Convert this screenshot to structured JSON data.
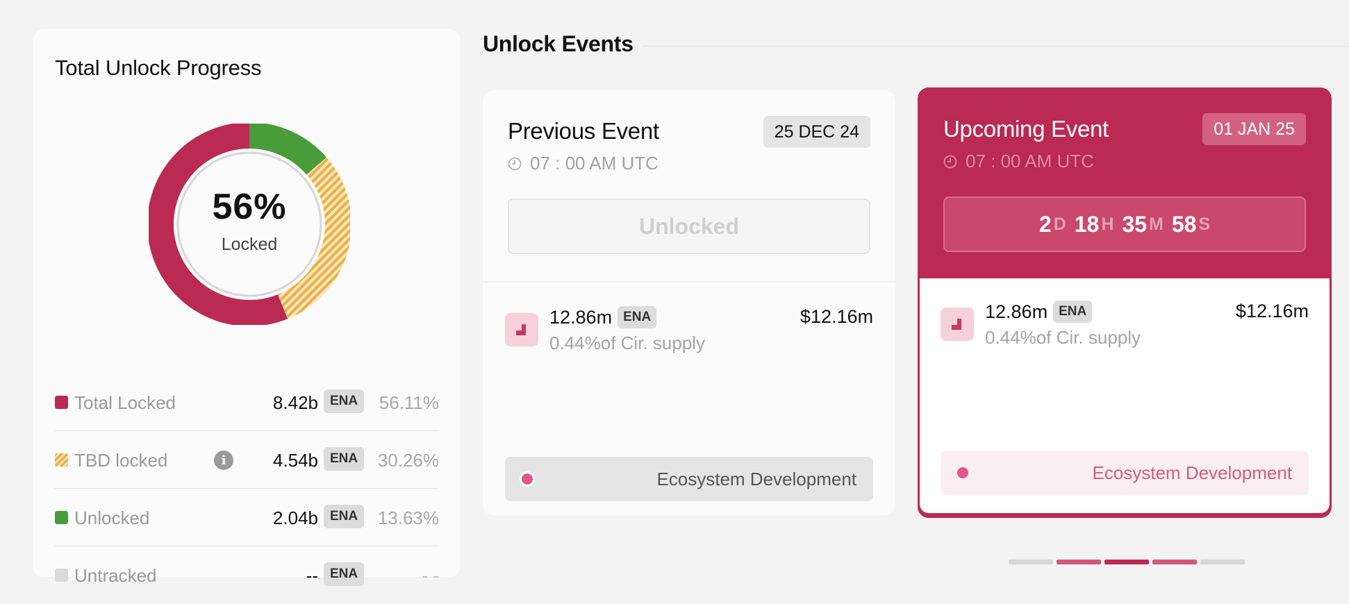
{
  "progress": {
    "title": "Total Unlock Progress",
    "percent_text": "56%",
    "center_label": "Locked",
    "segments": [
      {
        "name": "Total Locked",
        "fraction": 0.5611,
        "color": "#ba2a52"
      },
      {
        "name": "TBD locked",
        "fraction": 0.3026,
        "color": "#e9b046"
      },
      {
        "name": "Unlocked",
        "fraction": 0.1363,
        "color": "#4a9c3a"
      }
    ],
    "legend": [
      {
        "name": "Total Locked",
        "value": "8.42b",
        "token": "ENA",
        "pct": "56.11%",
        "color": "#ba2a52"
      },
      {
        "name": "TBD locked",
        "value": "4.54b",
        "token": "ENA",
        "pct": "30.26%",
        "color": "#e9b046",
        "info_icon": "info-icon"
      },
      {
        "name": "Unlocked",
        "value": "2.04b",
        "token": "ENA",
        "pct": "13.63%",
        "color": "#4a9c3a"
      },
      {
        "name": "Untracked",
        "value": "--",
        "token": "ENA",
        "pct": "- -",
        "color": "#dcd9d9"
      }
    ]
  },
  "events": {
    "title": "Unlock Events",
    "previous": {
      "title": "Previous Event",
      "date": "25 DEC 24",
      "time": "07 : 00 AM UTC",
      "status": "Unlocked",
      "amount": "12.86m",
      "token": "ENA",
      "supply": "0.44%of Cir. supply",
      "usd": "$12.16m",
      "category": "Ecosystem Development"
    },
    "upcoming": {
      "title": "Upcoming Event",
      "date": "01 JAN 25",
      "time": "07 : 00 AM UTC",
      "countdown": {
        "d": "2",
        "d_unit": "D",
        "h": "18",
        "h_unit": "H",
        "m": "35",
        "m_unit": "M",
        "s": "58",
        "s_unit": "S"
      },
      "amount": "12.86m",
      "token": "ENA",
      "supply": "0.44%of Cir. supply",
      "usd": "$12.16m",
      "category": "Ecosystem Development"
    }
  },
  "pager": {
    "colors": [
      "#d6d6d6",
      "#d4587b",
      "#ba2a52",
      "#d4587b",
      "#d6d6d6"
    ],
    "active_index": 2
  }
}
